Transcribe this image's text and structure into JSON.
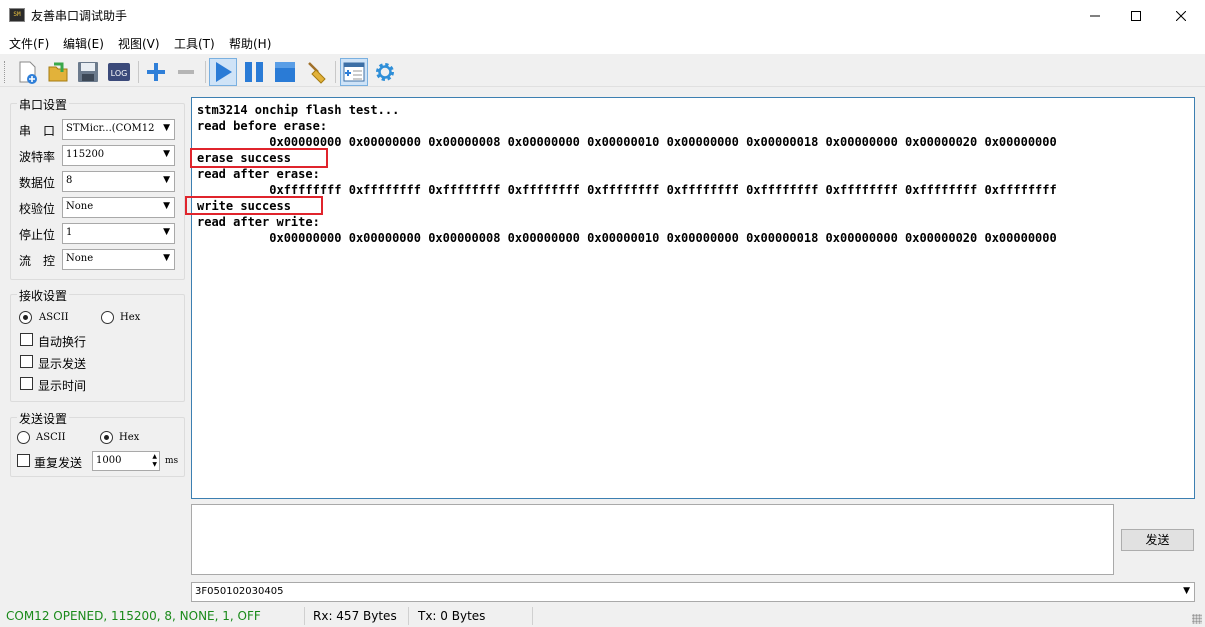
{
  "window": {
    "title": "友善串口调试助手",
    "icon_label": "SM"
  },
  "menu": [
    "文件(F)",
    "编辑(E)",
    "视图(V)",
    "工具(T)",
    "帮助(H)"
  ],
  "toolbar": {
    "icons": [
      "new-file-icon",
      "open-folder-icon",
      "save-icon",
      "log-icon",
      "add-icon",
      "remove-icon",
      "play-icon",
      "pause-icon",
      "stop-icon",
      "clear-broom-icon",
      "window-layout-icon",
      "gear-icon"
    ],
    "log_label": "LOG"
  },
  "serial_settings": {
    "title": "串口设置",
    "port_label": "串　口",
    "port_value": "STMicr...(COM12",
    "baud_label": "波特率",
    "baud_value": "115200",
    "databits_label": "数据位",
    "databits_value": "8",
    "parity_label": "校验位",
    "parity_value": "None",
    "stopbits_label": "停止位",
    "stopbits_value": "1",
    "flow_label": "流　控",
    "flow_value": "None"
  },
  "receive_settings": {
    "title": "接收设置",
    "ascii_label": "ASCII",
    "hex_label": "Hex",
    "mode": "ASCII",
    "auto_wrap_label": "自动换行",
    "show_send_label": "显示发送",
    "show_time_label": "显示时间"
  },
  "send_settings": {
    "title": "发送设置",
    "ascii_label": "ASCII",
    "hex_label": "Hex",
    "mode": "Hex",
    "repeat_label": "重复发送",
    "interval_value": "1000",
    "interval_unit": "ms"
  },
  "receive_text": [
    "stm3214 onchip flash test...",
    "read before erase:",
    "          0x00000000 0x00000000 0x00000008 0x00000000 0x00000010 0x00000000 0x00000018 0x00000000 0x00000020 0x00000000",
    "erase success",
    "read after erase:",
    "          0xffffffff 0xffffffff 0xffffffff 0xffffffff 0xffffffff 0xffffffff 0xffffffff 0xffffffff 0xffffffff 0xffffffff",
    "write success",
    "read after write:",
    "          0x00000000 0x00000000 0x00000008 0x00000000 0x00000010 0x00000000 0x00000018 0x00000000 0x00000020 0x00000000"
  ],
  "highlight_color": "#e0242c",
  "send_area": {
    "text": "",
    "send_button": "发送",
    "command_value": "3F050102030405"
  },
  "statusbar": {
    "port_status": "COM12 OPENED, 115200, 8, NONE, 1, OFF",
    "port_status_color": "#1a8a1a",
    "rx": "Rx: 457 Bytes",
    "tx": "Tx: 0 Bytes"
  }
}
